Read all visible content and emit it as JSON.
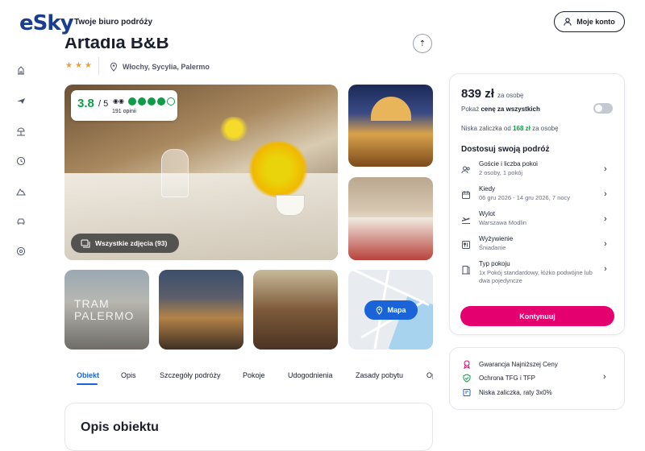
{
  "header": {
    "logo_text": "eSky",
    "tagline": "Twoje biuro podróży",
    "account_label": "Moje konto"
  },
  "sidebar": {
    "items": [
      {
        "icon": "hotel-icon"
      },
      {
        "icon": "plane-icon"
      },
      {
        "icon": "beach-icon"
      },
      {
        "icon": "clock-icon"
      },
      {
        "icon": "mountain-icon"
      },
      {
        "icon": "car-icon"
      },
      {
        "icon": "settings-icon"
      }
    ]
  },
  "hotel": {
    "name": "Artadia B&B",
    "stars": "★★★",
    "location": "Włochy, Sycylia, Palermo"
  },
  "rating": {
    "score": "3.8",
    "of": "/ 5",
    "reviews": "191 opinii",
    "filled_dots": 4,
    "total_dots": 5,
    "color": "#0d9d49"
  },
  "photos": {
    "all_label": "Wszystkie zdjęcia (93)",
    "tram_text": "TRAM PALERMO",
    "map_label": "Mapa"
  },
  "tabs": [
    "Obiekt",
    "Opis",
    "Szczegóły podróży",
    "Pokoje",
    "Udogodnienia",
    "Zasady pobytu",
    "Op"
  ],
  "section": {
    "title": "Opis obiektu"
  },
  "booking": {
    "price": "839 zł",
    "price_suffix": "za osobę",
    "toggle_prefix": "Pokaż",
    "toggle_bold": "cenę za wszystkich",
    "deposit_prefix": "Niska zaliczka od",
    "deposit_amount": "168 zł",
    "deposit_suffix": "za osobę",
    "customize_title": "Dostosuj swoją podróż",
    "rows": [
      {
        "title": "Goście i liczba pokoi",
        "sub": "2 osoby, 1 pokój",
        "icon": "guests-icon"
      },
      {
        "title": "Kiedy",
        "sub": "06 gru 2026 - 14 gru 2026, 7 nocy",
        "icon": "calendar-icon"
      },
      {
        "title": "Wylot",
        "sub": "Warszawa Modlin",
        "icon": "departure-icon"
      },
      {
        "title": "Wyżywienie",
        "sub": "Śniadanie",
        "icon": "meal-icon"
      },
      {
        "title": "Typ pokoju",
        "sub": "1x Pokój standardowy, łóżko podwójne lub dwa pojedyncze",
        "icon": "room-icon"
      }
    ],
    "continue_label": "Kontynuuj",
    "accent": "#e4006e"
  },
  "guarantees": [
    {
      "label": "Gwarancja Najniższej Ceny",
      "icon": "badge-icon"
    },
    {
      "label": "Ochrona TFG i TFP",
      "icon": "shield-icon"
    },
    {
      "label": "Niska zaliczka, raty 3x0%",
      "icon": "card-icon"
    }
  ]
}
